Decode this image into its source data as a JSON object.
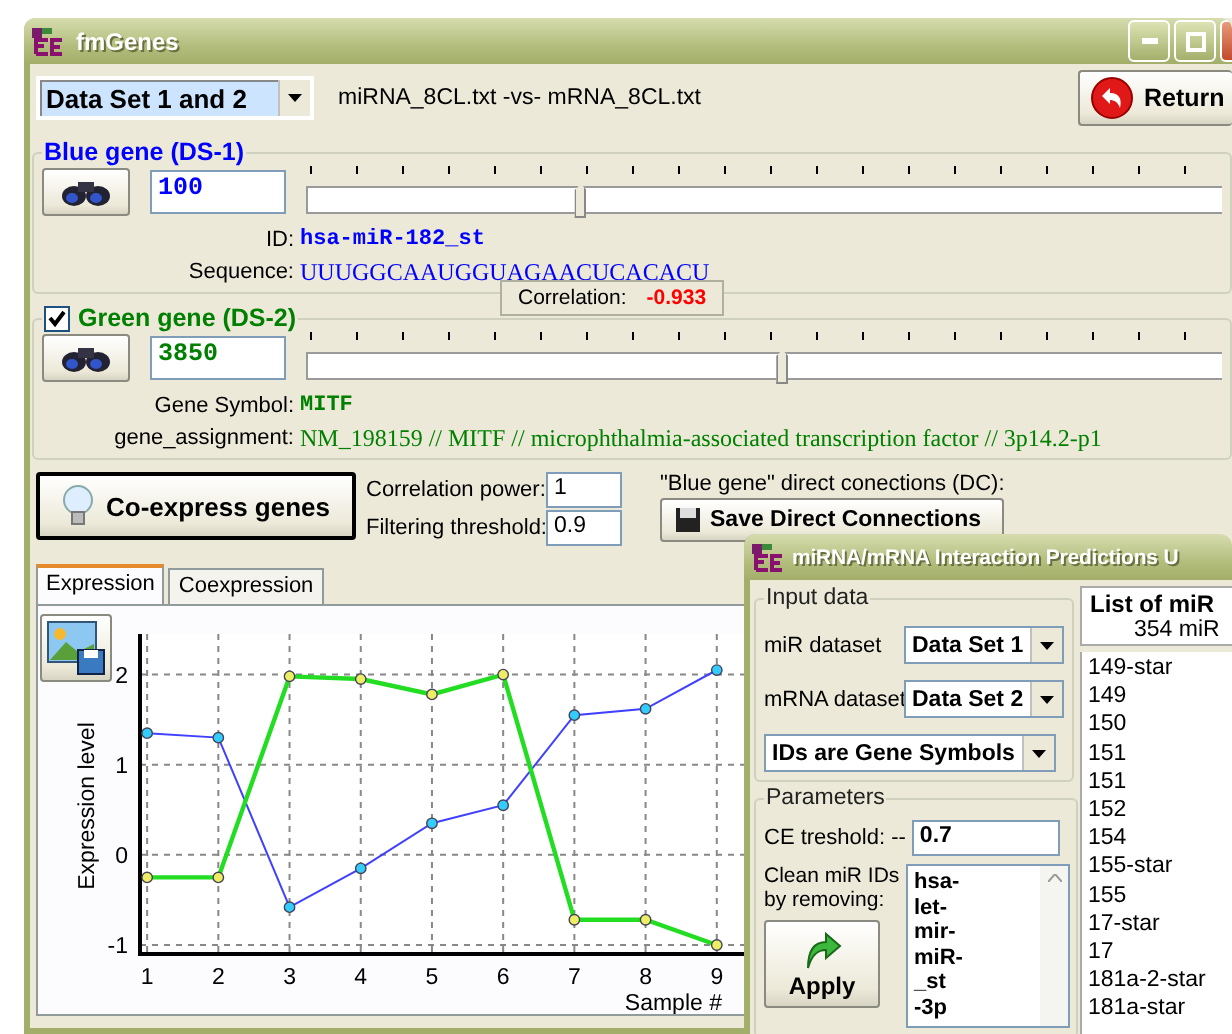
{
  "main_window": {
    "title": "fmGenes",
    "dataset_select": "Data Set 1 and 2",
    "files": "miRNA_8CL.txt -vs- mRNA_8CL.txt",
    "return_button": "Return"
  },
  "blue_gene": {
    "legend": "Blue gene (DS-1)",
    "index": "100",
    "level": 0.3,
    "fields": [
      {
        "label": "ID:",
        "value": "hsa-miR-182_st",
        "kind": "mono"
      },
      {
        "label": "Sequence:",
        "value": "UUUGGCAAUGGUAGAACUCACACU",
        "kind": "serif"
      }
    ]
  },
  "correlation": {
    "label": "Correlation:",
    "value": "-0.933"
  },
  "green_gene": {
    "legend": "Green gene (DS-2)",
    "checked": true,
    "index": "3850",
    "level": 0.52,
    "fields": [
      {
        "label": "Gene Symbol:",
        "value": "MITF",
        "kind": "mono"
      },
      {
        "label": "gene_assignment:",
        "value": "NM_198159 // MITF // microphthalmia-associated transcription factor // 3p14.2-p1",
        "kind": "serif"
      }
    ]
  },
  "coexpress_button": "Co-express genes",
  "params": [
    {
      "label": "Correlation power:",
      "value": "1"
    },
    {
      "label": "Filtering threshold:",
      "value": "0.9"
    }
  ],
  "direct_connections": {
    "label": "\"Blue gene\" direct conections (DC):",
    "button": "Save Direct Connections"
  },
  "tabs": [
    {
      "label": "Expression",
      "selected": true
    },
    {
      "label": "Coexpression",
      "selected": false
    }
  ],
  "chart_data": {
    "type": "line",
    "xlabel": "Sample #",
    "ylabel": "Expression level",
    "x": [
      1,
      2,
      3,
      4,
      5,
      6,
      7,
      8,
      9
    ],
    "xlim": [
      0.9,
      10
    ],
    "ylim": [
      -1.1,
      2.45
    ],
    "xticks": [
      1,
      2,
      3,
      4,
      5,
      6,
      7,
      8,
      9
    ],
    "yticks": [
      -1,
      0,
      1,
      2
    ],
    "grid": true,
    "series": [
      {
        "color": "#4040ff",
        "marker": "circle",
        "values": [
          1.35,
          1.3,
          -0.58,
          -0.15,
          0.35,
          0.55,
          1.55,
          1.62,
          2.05
        ]
      },
      {
        "color": "#22dd22",
        "marker": "circle",
        "values": [
          -0.25,
          -0.25,
          1.98,
          1.95,
          1.78,
          2.0,
          -0.72,
          -0.72,
          -1.0
        ]
      }
    ]
  },
  "predictions_window": {
    "title": "miRNA/mRNA Interaction Predictions U",
    "input_group": "Input data",
    "selects": [
      {
        "label": "miR dataset",
        "value": "Data Set 1"
      },
      {
        "label": "mRNA dataset",
        "value": "Data Set 2"
      },
      {
        "value": "IDs are Gene Symbols"
      }
    ],
    "params_group": "Parameters",
    "ce_label": "CE treshold: --",
    "ce_value": "0.7",
    "clean_label": "Clean miR IDs by removing:",
    "clean_items": [
      "hsa-",
      "let-",
      "mir-",
      "miR-",
      "_st",
      "-3p"
    ],
    "apply_button": "Apply",
    "list_header": "List of miR",
    "list_count": "354 miR",
    "list_items": [
      "149-star",
      "149",
      "150",
      "151",
      "151",
      "152",
      "154",
      "155-star",
      "155",
      "17-star",
      "17",
      "181a-2-star",
      "181a-star"
    ]
  }
}
